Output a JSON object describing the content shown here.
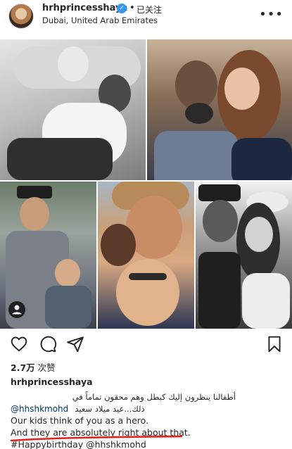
{
  "header": {
    "username": "hrhprincesshaya",
    "separator": "•",
    "follow_status": "已关注",
    "location": "Dubai, United Arab Emirates",
    "more_icon": "more-horizontal-icon"
  },
  "post": {
    "likes_count": "2.7万",
    "likes_label": "次赞",
    "caption_username": "hrhprincesshaya",
    "caption_arabic_line1": "أطفالنا ينظرون إليك كبطل وهم محقون تماماً في",
    "caption_arabic_line2": "ذلك...عيد ميلاد سعيد",
    "caption_arabic_mention": "@hhshkmohd",
    "caption_en_line1": "Our kids think of you as a hero.",
    "caption_en_line2": "And they are absolutely right about that.",
    "caption_en_line3": "#Happybirthday @hhshkmohd"
  },
  "colors": {
    "verified": "#3897f0",
    "underline": "#e0241b",
    "mention": "#00376b"
  }
}
